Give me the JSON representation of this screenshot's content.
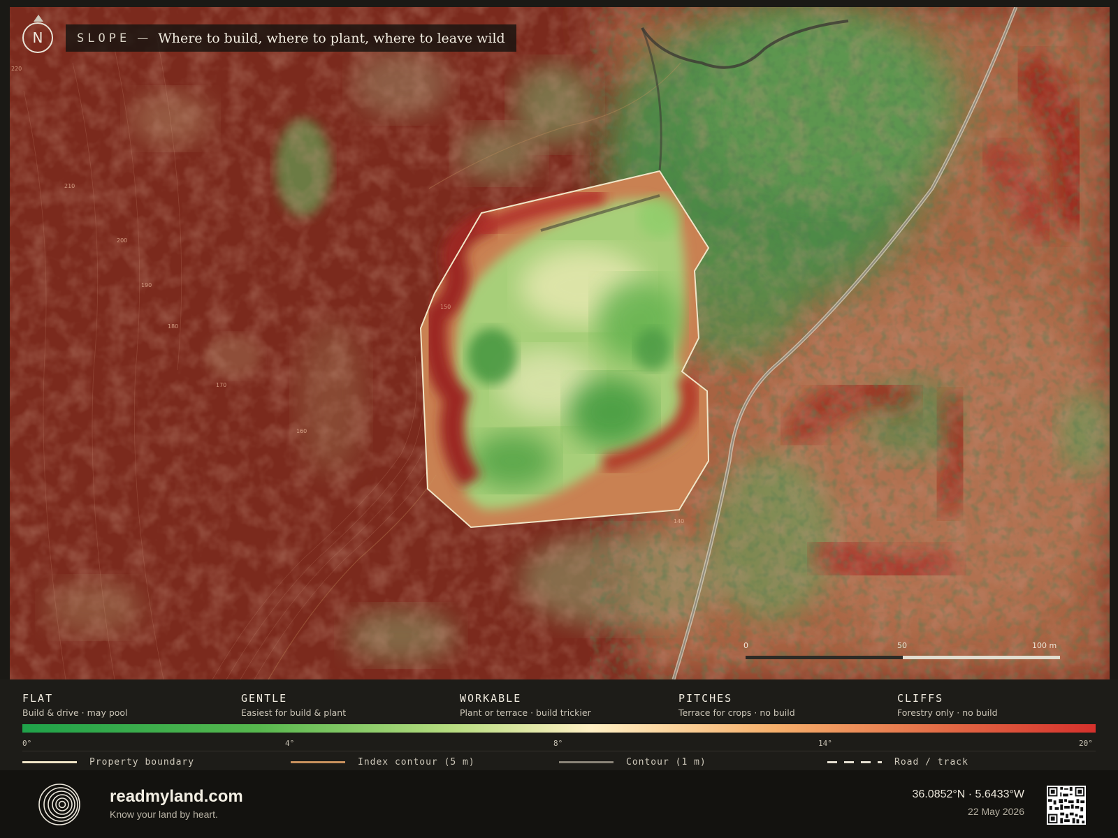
{
  "map": {
    "north_label": "N",
    "title_key": "SLOPE",
    "title_separator": "—",
    "title_text": "Where to build, where to plant, where to leave wild",
    "contour_labels": [
      "220",
      "210",
      "200",
      "190",
      "180",
      "170",
      "160",
      "150",
      "140"
    ],
    "scale_bar": {
      "labels": [
        "0",
        "50",
        "100 m"
      ]
    }
  },
  "legend": {
    "categories": [
      {
        "name": "FLAT",
        "description": "Build & drive · may pool"
      },
      {
        "name": "GENTLE",
        "description": "Easiest for build & plant"
      },
      {
        "name": "WORKABLE",
        "description": "Plant or terrace · build trickier"
      },
      {
        "name": "PITCHES",
        "description": "Terrace for crops · no build"
      },
      {
        "name": "CLIFFS",
        "description": "Forestry only · no build"
      }
    ],
    "gradient_ticks": [
      "0°",
      "4°",
      "8°",
      "14°",
      "20°"
    ],
    "gradient_colors": [
      "#1fa24a",
      "#b7dc80",
      "#fff0c4",
      "#f6b06c",
      "#d6312c"
    ],
    "keys": [
      {
        "label": "Property boundary",
        "color": "#f1e6c8",
        "style": "solid"
      },
      {
        "label": "Index contour (5 m)",
        "color": "#c9925e",
        "style": "solid"
      },
      {
        "label": "Contour (1 m)",
        "color": "#8a8478",
        "style": "solid"
      },
      {
        "label": "Road / track",
        "color": "#e6e0d2",
        "style": "dashed"
      }
    ]
  },
  "footer": {
    "brand": "readmyland.com",
    "tagline": "Know your land by heart.",
    "coordinates": "36.0852°N · 5.6433°W",
    "date": "22 May 2026",
    "qr_icon": "qr-code-icon",
    "logo_icon": "concentric-rings-logo"
  }
}
